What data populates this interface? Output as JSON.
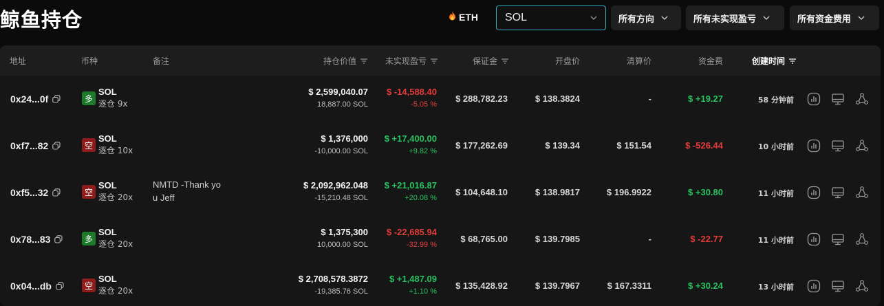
{
  "header": {
    "title": "鲸鱼持仓",
    "eth_chip": "ETH",
    "coin_select": {
      "value": "SOL"
    },
    "filters": [
      "所有方向",
      "所有未实现盈亏",
      "所有资金费用"
    ]
  },
  "table": {
    "columns": {
      "address": "地址",
      "coin": "币种",
      "note": "备注",
      "position_value": "持仓价值",
      "unrealized_pnl": "未实现盈亏",
      "margin": "保证金",
      "entry_price": "开盘价",
      "liq_price": "清算价",
      "funding": "资金费",
      "created": "创建时间"
    },
    "rows": [
      {
        "address": "0x24...0f",
        "side": "多",
        "side_type": "long",
        "coin": "SOL",
        "leverage": "逐仓 9x",
        "note": "",
        "value": "$ 2,599,040.07",
        "size": "18,887.00 SOL",
        "pnl": "$ -14,588.40",
        "pnl_pct": "-5.05 %",
        "pnl_sign": "neg",
        "margin": "$ 288,782.23",
        "entry": "$ 138.3824",
        "liq": "-",
        "funding": "$ +19.27",
        "funding_sign": "pos",
        "created": "58 分钟前"
      },
      {
        "address": "0xf7...82",
        "side": "空",
        "side_type": "short",
        "coin": "SOL",
        "leverage": "逐仓 10x",
        "note": "",
        "value": "$ 1,376,000",
        "size": "-10,000.00 SOL",
        "pnl": "$ +17,400.00",
        "pnl_pct": "+9.82 %",
        "pnl_sign": "pos",
        "margin": "$ 177,262.69",
        "entry": "$ 139.34",
        "liq": "$ 151.54",
        "funding": "$ -526.44",
        "funding_sign": "neg",
        "created": "10 小时前"
      },
      {
        "address": "0xf5...32",
        "side": "空",
        "side_type": "short",
        "coin": "SOL",
        "leverage": "逐仓 20x",
        "note": "NMTD -Thank you Jeff",
        "value": "$ 2,092,962.048",
        "size": "-15,210.48 SOL",
        "pnl": "$ +21,016.87",
        "pnl_pct": "+20.08 %",
        "pnl_sign": "pos",
        "margin": "$ 104,648.10",
        "entry": "$ 138.9817",
        "liq": "$ 196.9922",
        "funding": "$ +30.80",
        "funding_sign": "pos",
        "created": "11 小时前"
      },
      {
        "address": "0x78...83",
        "side": "多",
        "side_type": "long",
        "coin": "SOL",
        "leverage": "逐仓 20x",
        "note": "",
        "value": "$ 1,375,300",
        "size": "10,000.00 SOL",
        "pnl": "$ -22,685.94",
        "pnl_pct": "-32.99 %",
        "pnl_sign": "neg",
        "margin": "$ 68,765.00",
        "entry": "$ 139.7985",
        "liq": "-",
        "funding": "$ -22.77",
        "funding_sign": "neg",
        "created": "11 小时前"
      },
      {
        "address": "0x04...db",
        "side": "空",
        "side_type": "short",
        "coin": "SOL",
        "leverage": "逐仓 20x",
        "note": "",
        "value": "$ 2,708,578.3872",
        "size": "-19,385.76 SOL",
        "pnl": "$ +1,487.09",
        "pnl_pct": "+1.10 %",
        "pnl_sign": "pos",
        "margin": "$ 135,428.92",
        "entry": "$ 139.7967",
        "liq": "$ 167.3311",
        "funding": "$ +30.24",
        "funding_sign": "pos",
        "created": "13 小时前"
      }
    ]
  },
  "colors": {
    "accent_border": "#2fb1c4",
    "positive": "#27c25f",
    "negative": "#e53b3b"
  },
  "icons": [
    "flame-icon",
    "chevron-down-icon",
    "sort-icon",
    "copy-icon",
    "chart-icon",
    "monitor-icon",
    "share-icon"
  ]
}
